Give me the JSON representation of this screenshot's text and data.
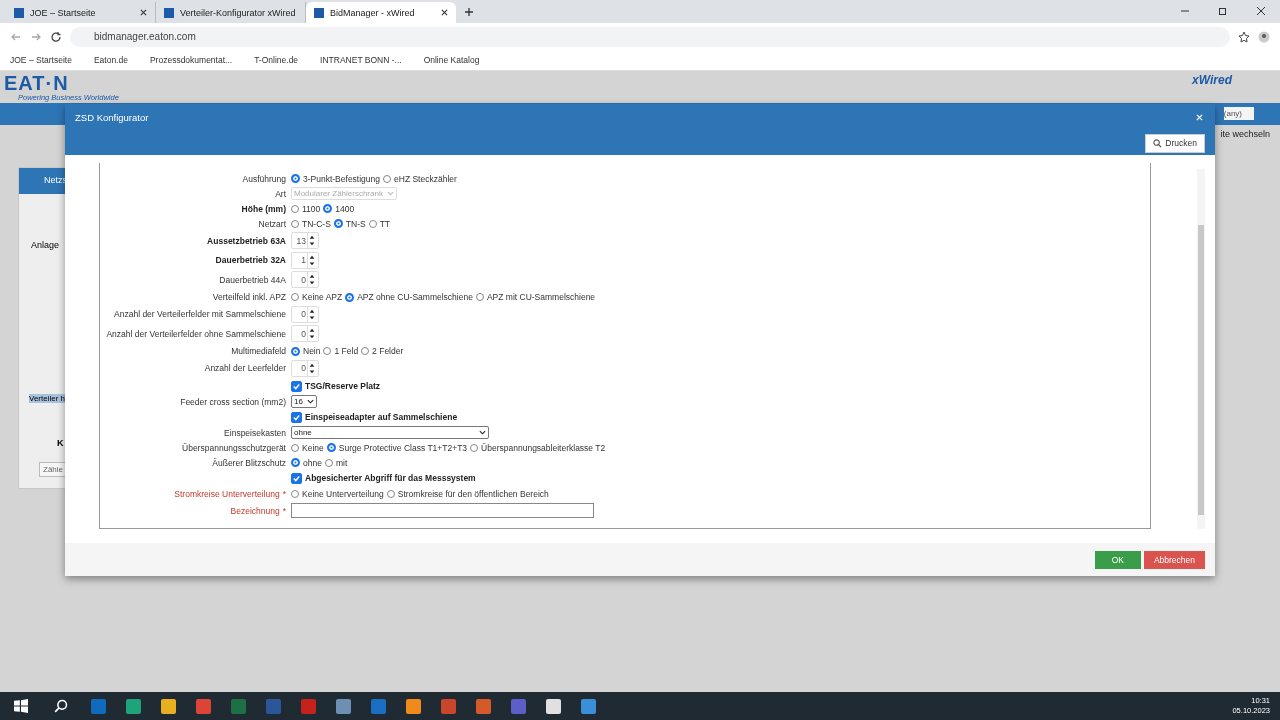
{
  "browser": {
    "tabs": [
      {
        "title": "JOE – Startseite",
        "selected": false
      },
      {
        "title": "Verteiler-Konfigurator xWired",
        "selected": false
      },
      {
        "title": "BidManager - xWired",
        "selected": true
      }
    ],
    "address": "bidmanager.eaton.com",
    "bookmarks": [
      "JOE – Startseite",
      "Eaton.de",
      "Prozessdokumentat...",
      "T-Online.de",
      "INTRANET BONN -...",
      "Online Katalog"
    ]
  },
  "app": {
    "logo": "EAT·N",
    "tagline": "Powering Business Worldwide",
    "brand": "xWired",
    "filter": "(any)",
    "switch_label": "ite wechseln",
    "panel_title": "Netzs",
    "section_label": "Anlage",
    "highlight": "Verteiler h",
    "table_head": "K",
    "table_button": "Zähle"
  },
  "dialog": {
    "title": "ZSD Konfigurator",
    "print_button": "Drucken",
    "fields": [
      {
        "kind": "radio",
        "label": "Ausführung",
        "strong": false,
        "options": [
          {
            "label": "3-Punkt-Befestigung",
            "selected": true
          },
          {
            "label": "eHZ Steckzähler",
            "selected": false
          }
        ]
      },
      {
        "kind": "select",
        "label": "Art",
        "strong": false,
        "value": "Modularer Zählerschrank",
        "disabled": true
      },
      {
        "kind": "radio",
        "label": "Höhe (mm)",
        "strong": true,
        "options": [
          {
            "label": "1100",
            "selected": false
          },
          {
            "label": "1400",
            "selected": true
          }
        ]
      },
      {
        "kind": "radio",
        "label": "Netzart",
        "strong": false,
        "options": [
          {
            "label": "TN-C-S",
            "selected": false
          },
          {
            "label": "TN-S",
            "selected": true
          },
          {
            "label": "TT",
            "selected": false
          }
        ]
      },
      {
        "kind": "number",
        "label": "Aussetzbetrieb 63A",
        "strong": true,
        "value": "13"
      },
      {
        "kind": "number",
        "label": "Dauerbetrieb 32A",
        "strong": true,
        "value": "1"
      },
      {
        "kind": "number",
        "label": "Dauerbetrieb 44A",
        "strong": false,
        "value": "0"
      },
      {
        "kind": "radio",
        "label": "Verteilfeld inkl. APZ",
        "strong": false,
        "options": [
          {
            "label": "Keine APZ",
            "selected": false
          },
          {
            "label": "APZ ohne CU-Sammelschiene",
            "selected": true
          },
          {
            "label": "APZ mit CU-Sammelschiene",
            "selected": false
          }
        ]
      },
      {
        "kind": "number",
        "label": "Anzahl der Verteilerfelder mit Sammelschiene",
        "strong": false,
        "value": "0"
      },
      {
        "kind": "number",
        "label": "Anzahl der Verteilerfelder ohne Sammelschiene",
        "strong": false,
        "value": "0"
      },
      {
        "kind": "radio",
        "label": "Multimediafeld",
        "strong": false,
        "options": [
          {
            "label": "Nein",
            "selected": true
          },
          {
            "label": "1 Feld",
            "selected": false
          },
          {
            "label": "2 Felder",
            "selected": false
          }
        ]
      },
      {
        "kind": "number",
        "label": "Anzahl der Leerfelder",
        "strong": false,
        "value": "0"
      },
      {
        "kind": "checkbox",
        "text": "TSG/Reserve Platz",
        "checked": true
      },
      {
        "kind": "select",
        "label": "Feeder cross section (mm2)",
        "strong": false,
        "value": "16",
        "disabled": false
      },
      {
        "kind": "checkbox",
        "text": "Einspeiseadapter auf Sammelschiene",
        "checked": true
      },
      {
        "kind": "combo",
        "label": "Einspeisekasten",
        "strong": false,
        "value": "ohne"
      },
      {
        "kind": "radio",
        "label": "Überspannungsschutzgerät",
        "strong": false,
        "options": [
          {
            "label": "Keine",
            "selected": false
          },
          {
            "label": "Surge Protective Class T1+T2+T3",
            "selected": true
          },
          {
            "label": "Überspannungsableiterklasse T2",
            "selected": false
          }
        ]
      },
      {
        "kind": "radio",
        "label": "Äußerer Blitzschutz",
        "strong": false,
        "options": [
          {
            "label": "ohne",
            "selected": true
          },
          {
            "label": "mit",
            "selected": false
          }
        ]
      },
      {
        "kind": "checkbox",
        "text": "Abgesicherter Abgriff für das Messsystem",
        "checked": true
      },
      {
        "kind": "radio",
        "label": "Stromkreise Unterverteilung",
        "strong": false,
        "required_mark": "*",
        "options": [
          {
            "label": "Keine Unterverteilung",
            "selected": false
          },
          {
            "label": "Stromkreise für den öffentlichen Bereich",
            "selected": false
          }
        ]
      },
      {
        "kind": "text",
        "label": "Bezeichnung",
        "strong": false,
        "required_mark": "*"
      }
    ],
    "ok_button": "OK",
    "cancel_button": "Abbrechen"
  },
  "taskbar": {
    "apps": [
      {
        "color": "#0f6cbd"
      },
      {
        "color": "#1fa37a"
      },
      {
        "color": "#e8b020"
      },
      {
        "color": "#db4437"
      },
      {
        "color": "#1d7044"
      },
      {
        "color": "#2b579a"
      },
      {
        "color": "#c4221a"
      },
      {
        "color": "#6d8fb3"
      },
      {
        "color": "#1b6fc2"
      },
      {
        "color": "#f08a1c"
      },
      {
        "color": "#c9452b"
      },
      {
        "color": "#d45a2a"
      },
      {
        "color": "#5b5fc7"
      },
      {
        "color": "#e0e0e0"
      },
      {
        "color": "#3a8fd8"
      }
    ],
    "time": "10:31",
    "date": "05.10.2023"
  }
}
